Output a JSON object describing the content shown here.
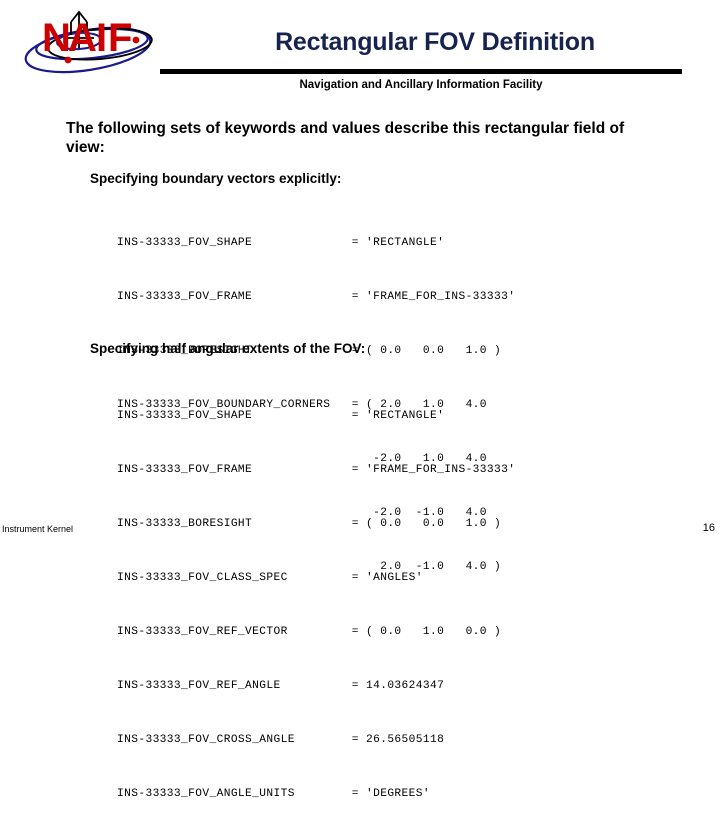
{
  "header": {
    "title": "Rectangular FOV Definition",
    "subtitle": "Navigation and Ancillary Information Facility",
    "logo_text": "NAIF",
    "title_color": "#17224f",
    "logo_letter_color": "#cc0000",
    "logo_orbit_color": "#1a1a8c"
  },
  "body": {
    "intro": "The following sets of keywords and values describe this rectangular field of view:",
    "heading_1": "Specifying boundary vectors explicitly:",
    "heading_2": "Specifying half angular extents of the FOV:"
  },
  "code_block_1": {
    "lines": [
      "INS-33333_FOV_SHAPE              = 'RECTANGLE'",
      "INS-33333_FOV_FRAME              = 'FRAME_FOR_INS-33333'",
      "INS-33333_BORESIGHT              = ( 0.0   0.0   1.0 )",
      "INS-33333_FOV_BOUNDARY_CORNERS   = ( 2.0   1.0   4.0",
      "                                    -2.0   1.0   4.0",
      "                                    -2.0  -1.0   4.0",
      "                                     2.0  -1.0   4.0 )"
    ]
  },
  "code_block_2": {
    "lines": [
      "INS-33333_FOV_SHAPE              = 'RECTANGLE'",
      "INS-33333_FOV_FRAME              = 'FRAME_FOR_INS-33333'",
      "INS-33333_BORESIGHT              = ( 0.0   0.0   1.0 )",
      "INS-33333_FOV_CLASS_SPEC         = 'ANGLES'",
      "INS-33333_FOV_REF_VECTOR         = ( 0.0   1.0   0.0 )",
      "INS-33333_FOV_REF_ANGLE          = 14.03624347",
      "INS-33333_FOV_CROSS_ANGLE        = 26.56505118",
      "INS-33333_FOV_ANGLE_UNITS        = 'DEGREES'"
    ]
  },
  "footer": {
    "left_label": "Instrument Kernel",
    "page_number": "16"
  }
}
